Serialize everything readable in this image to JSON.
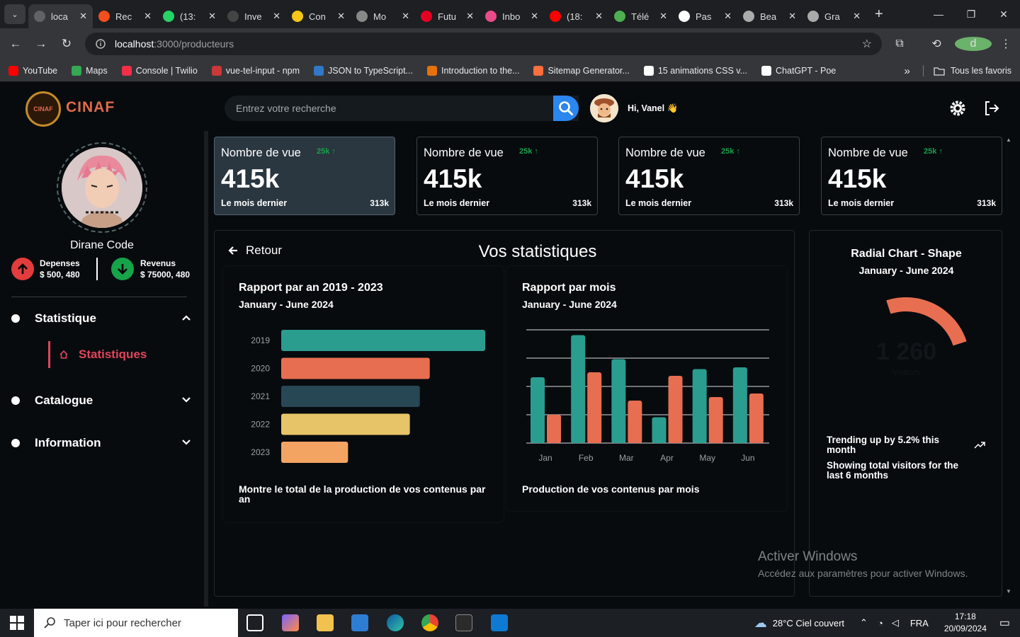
{
  "browser": {
    "tabs": [
      {
        "title": "loca",
        "color": "#5f6368"
      },
      {
        "title": "Rec",
        "color": "#f24e1e"
      },
      {
        "title": "(13:",
        "color": "#25d366"
      },
      {
        "title": "Inve",
        "color": "#444444"
      },
      {
        "title": "Con",
        "color": "#f5c518"
      },
      {
        "title": "Mo",
        "color": "#888888"
      },
      {
        "title": "Futu",
        "color": "#e60023"
      },
      {
        "title": "Inbo",
        "color": "#ea4c89"
      },
      {
        "title": "(18:",
        "color": "#ff0000"
      },
      {
        "title": "Télé",
        "color": "#4caf50"
      },
      {
        "title": "Pas",
        "color": "#ffffff"
      },
      {
        "title": "Bea",
        "color": "#aaaaaa"
      },
      {
        "title": "Gra",
        "color": "#aaaaaa"
      }
    ],
    "url_host": "localhost",
    "url_path": ":3000/producteurs",
    "profile_initial": "d",
    "bookmarks": [
      {
        "label": "YouTube",
        "color": "#ff0000"
      },
      {
        "label": "Maps",
        "color": "#34a853"
      },
      {
        "label": "Console | Twilio",
        "color": "#f22f46"
      },
      {
        "label": "vue-tel-input - npm",
        "color": "#cb3837"
      },
      {
        "label": "JSON to TypeScript...",
        "color": "#3178c6"
      },
      {
        "label": "Introduction to the...",
        "color": "#e8710a"
      },
      {
        "label": "Sitemap Generator...",
        "color": "#ff6f3c"
      },
      {
        "label": "15 animations CSS v...",
        "color": "#ffffff"
      },
      {
        "label": "ChatGPT - Poe",
        "color": "#ffffff"
      }
    ],
    "all_bookmarks": "Tous les favoris"
  },
  "header": {
    "brand": "CINAF",
    "logo_text": "CINAF",
    "search_placeholder": "Entrez votre recherche",
    "greeting": "Hi, Vanel 👋"
  },
  "sidebar": {
    "name": "Dirane Code",
    "expense_label": "Depenses",
    "expense_value": "$ 500, 480",
    "revenue_label": "Revenus",
    "revenue_value": "$ 75000, 480",
    "menu": [
      "Statistique",
      "Catalogue",
      "Information"
    ],
    "submenu": "Statistiques"
  },
  "cards": [
    {
      "title": "Nombre de vue",
      "trend": "25k",
      "value": "415k",
      "footer": "Le mois dernier",
      "footer_value": "313k"
    },
    {
      "title": "Nombre de vue",
      "trend": "25k",
      "value": "415k",
      "footer": "Le mois dernier",
      "footer_value": "313k"
    },
    {
      "title": "Nombre de vue",
      "trend": "25k",
      "value": "415k",
      "footer": "Le mois dernier",
      "footer_value": "313k"
    },
    {
      "title": "Nombre de vue",
      "trend": "25k",
      "value": "415k",
      "footer": "Le mois dernier",
      "footer_value": "313k"
    }
  ],
  "stats": {
    "back": "Retour",
    "title": "Vos statistiques",
    "yearly": {
      "heading": "Rapport par an 2019 - 2023",
      "date": "January - June 2024",
      "footer": "Montre le total de la production de vos contenus par an"
    },
    "monthly": {
      "heading": "Rapport par mois",
      "date": "January - June 2024",
      "footer": "Production de vos contenus par mois"
    }
  },
  "radial": {
    "title": "Radial Chart - Shape",
    "date": "January - June 2024",
    "number": "1 260",
    "label": "Visitors",
    "trend": "Trending up by 5.2% this month",
    "desc": "Showing total visitors for the last 6 months"
  },
  "chart_data": [
    {
      "type": "bar",
      "orientation": "horizontal",
      "categories": [
        "2019",
        "2020",
        "2021",
        "2022",
        "2023"
      ],
      "values": [
        287,
        209,
        195,
        181,
        94
      ],
      "colors": [
        "#2a9d8f",
        "#e76e50",
        "#274754",
        "#e8c468",
        "#f4a462"
      ],
      "grid": false
    },
    {
      "type": "bar",
      "categories": [
        "Jan",
        "Feb",
        "Mar",
        "Apr",
        "May",
        "Jun"
      ],
      "series": [
        {
          "color": "#2a9d8f",
          "values": [
            186,
            305,
            237,
            73,
            209,
            214
          ]
        },
        {
          "color": "#e76e50",
          "values": [
            80,
            200,
            120,
            190,
            130,
            140
          ]
        }
      ],
      "ylim": [
        0,
        320
      ],
      "grid": true
    }
  ],
  "watermark": {
    "line1": "Activer Windows",
    "line2": "Accédez aux paramètres pour activer Windows."
  },
  "taskbar": {
    "search_placeholder": "Taper ici pour rechercher",
    "weather": "28°C  Ciel couvert",
    "lang": "FRA",
    "time": "17:18",
    "date": "20/09/2024"
  }
}
